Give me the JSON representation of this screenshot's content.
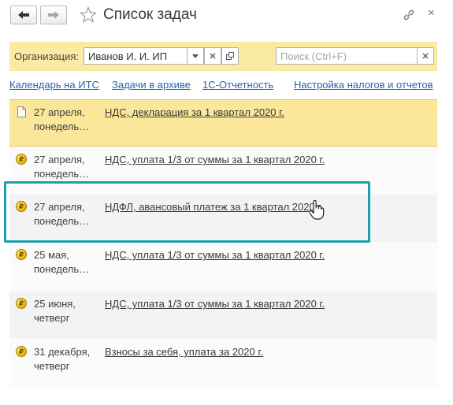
{
  "window": {
    "title": "Список задач",
    "icons": [
      "back-arrow-icon",
      "forward-arrow-icon",
      "star-icon",
      "link-icon",
      "close-icon"
    ],
    "close_glyph": "×"
  },
  "toolbar": {
    "org_label": "Организация:",
    "org_value": "Иванов И. И. ИП",
    "search_placeholder": "Поиск (Ctrl+F)",
    "background": "#fbeaa2"
  },
  "links": [
    "Календарь на ИТС",
    "Задачи в архиве",
    "1С-Отчетность",
    "Настройка налогов и отчетов"
  ],
  "tasks": [
    {
      "date": "27 апреля,",
      "weekday": "понедель…",
      "title": "НДС, декларация за 1 квартал 2020 г.",
      "icon": "document-icon",
      "selected": true
    },
    {
      "date": "27 апреля,",
      "weekday": "понедель…",
      "title": "НДС, уплата 1/3 от суммы за 1 квартал 2020 г.",
      "icon": "ruble-coin-icon"
    },
    {
      "date": "27 апреля,",
      "weekday": "понедель…",
      "title": "НДФЛ, авансовый платеж за 1 квартал 2020 г.",
      "icon": "ruble-coin-icon",
      "highlighted": true
    },
    {
      "date": "25 мая,",
      "weekday": "понедель…",
      "title": "НДС, уплата 1/3 от суммы за 1 квартал 2020 г.",
      "icon": "ruble-coin-icon"
    },
    {
      "date": "25 июня,",
      "weekday": "четверг",
      "title": "НДС, уплата 1/3 от суммы за 1 квартал 2020 г.",
      "icon": "ruble-coin-icon"
    },
    {
      "date": "31 декабря,",
      "weekday": "четверг",
      "title": "Взносы за себя, уплата за 2020 г.",
      "icon": "ruble-coin-icon"
    }
  ],
  "colors": {
    "selected_row": "#fbe79a",
    "highlight_frame": "#1aa0b0",
    "link": "#2a62b0"
  }
}
